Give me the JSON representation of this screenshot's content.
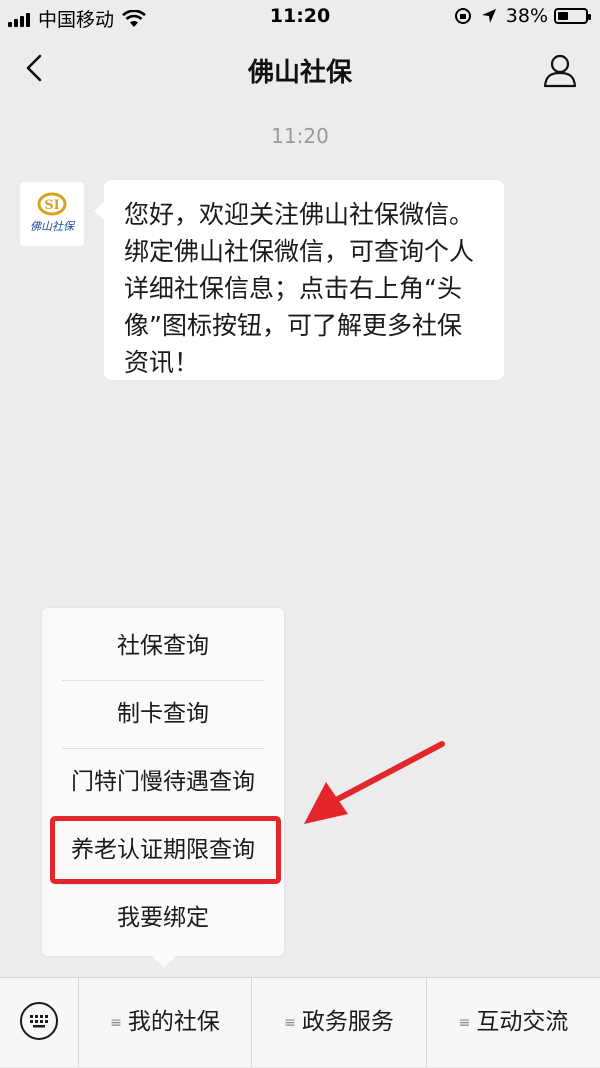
{
  "status_bar": {
    "carrier": "中国移动",
    "time": "11:20",
    "battery_percent": "38%",
    "battery_level": 0.38
  },
  "nav": {
    "title": "佛山社保",
    "back_icon": "chevron-left-icon",
    "profile_icon": "person-icon"
  },
  "chat": {
    "timestamp": "11:20",
    "avatar_text": "佛山社保",
    "messages": [
      {
        "text": "您好，欢迎关注佛山社保微信。绑定佛山社保微信，可查询个人详细社保信息；点击右上角“头像”图标按钮，可了解更多社保资讯！"
      }
    ]
  },
  "menu": {
    "items": [
      {
        "label": "社保查询"
      },
      {
        "label": "制卡查询"
      },
      {
        "label": "门特门慢待遇查询"
      },
      {
        "label": "养老认证期限查询"
      },
      {
        "label": "我要绑定"
      }
    ]
  },
  "tabbar": {
    "keyboard_icon": "keyboard-icon",
    "tabs": [
      {
        "label": "我的社保"
      },
      {
        "label": "政务服务"
      },
      {
        "label": "互动交流"
      }
    ]
  },
  "colors": {
    "highlight": "#e3262b",
    "background": "#ececec"
  }
}
